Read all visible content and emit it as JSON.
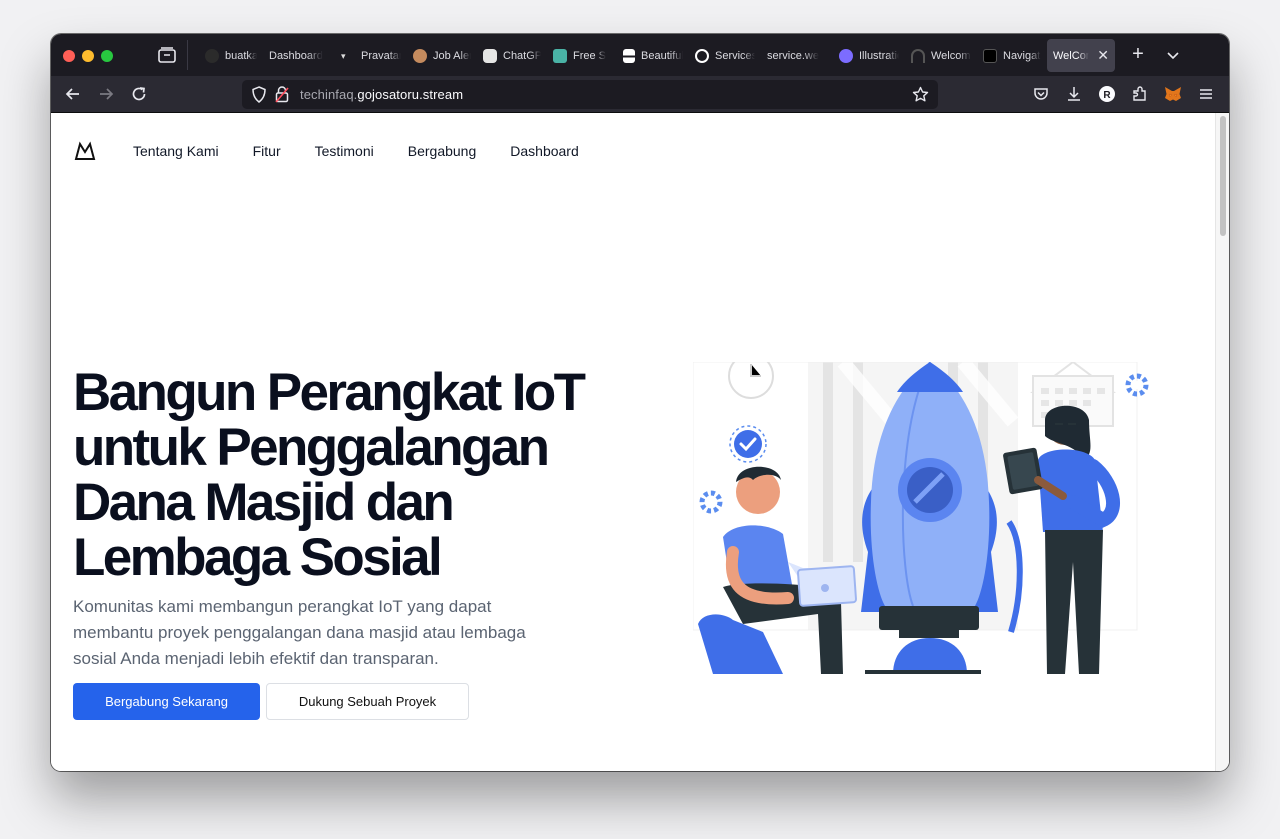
{
  "browser": {
    "tabs": [
      {
        "label": "buatkan",
        "icon": "github-icon",
        "color": "#2b2b2b"
      },
      {
        "label": "Dashboard",
        "icon": "blank-page-icon",
        "color": "#1c1b22"
      },
      {
        "label": "Pravatar",
        "icon": "pravatar-icon",
        "color": "#1c1b22"
      },
      {
        "label": "Job Alert",
        "icon": "avatar-icon",
        "color": "#c58b5e"
      },
      {
        "label": "ChatGPT",
        "icon": "chatgpt-icon",
        "color": "#e5e5e5"
      },
      {
        "label": "Free S",
        "icon": "document-icon",
        "color": "#4ab3a6"
      },
      {
        "label": "Beautiful",
        "icon": "unsplash-icon",
        "color": "#ffffff"
      },
      {
        "label": "Services",
        "icon": "services-icon",
        "color": "#ffffff"
      },
      {
        "label": "service.we",
        "icon": "none",
        "color": "#1c1b22"
      },
      {
        "label": "Illustrations",
        "icon": "storyset-icon",
        "color": "#7c6cff"
      },
      {
        "label": "Welcome",
        "icon": "headphones-icon",
        "color": "#1c1b22"
      },
      {
        "label": "Navigation",
        "icon": "pen-icon",
        "color": "#000000"
      },
      {
        "label": "WelCome",
        "icon": "none",
        "color": "#42414d",
        "active": true
      }
    ],
    "url": {
      "prefix": "techinfaq.",
      "domain": "gojosatoru.stream"
    }
  },
  "site": {
    "nav": [
      "Tentang Kami",
      "Fitur",
      "Testimoni",
      "Bergabung",
      "Dashboard"
    ],
    "hero": {
      "title": "Bangun Perangkat IoT untuk Penggalangan Dana Masjid dan Lembaga Sosial",
      "subtitle": "Komunitas kami membangun perangkat IoT yang dapat membantu proyek penggalangan dana masjid atau lembaga sosial Anda menjadi lebih efektif dan transparan.",
      "primary_button": "Bergabung Sekarang",
      "secondary_button": "Dukung Sebuah Proyek"
    },
    "colors": {
      "accent": "#2563eb",
      "illustration_blue": "#4f7ff2",
      "illustration_dark": "#263238"
    }
  }
}
